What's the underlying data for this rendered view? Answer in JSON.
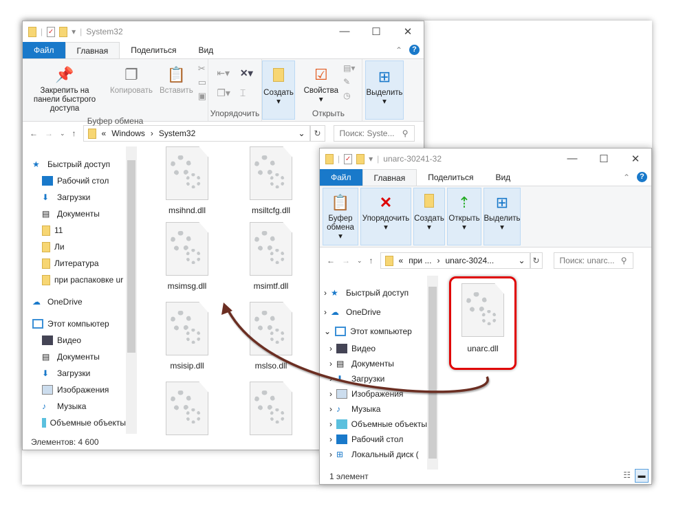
{
  "window1": {
    "title": "System32",
    "tabs": [
      "Файл",
      "Главная",
      "Поделиться",
      "Вид"
    ],
    "ribbon": {
      "pin": "Закрепить на панели быстрого доступа",
      "copy": "Копировать",
      "paste": "Вставить",
      "clipboard_group": "Буфер обмена",
      "organize_group": "Упорядочить",
      "create": "Создать",
      "properties": "Свойства",
      "open_group": "Открыть",
      "select": "Выделить"
    },
    "address": {
      "prefix": "«",
      "crumbs": [
        "Windows",
        "System32"
      ],
      "search_placeholder": "Поиск: Syste..."
    },
    "nav": [
      "Быстрый доступ",
      "Рабочий стол",
      "Загрузки",
      "Документы",
      "11",
      "Ли",
      "Литература",
      "при распаковке ur",
      "OneDrive",
      "Этот компьютер",
      "Видео",
      "Документы",
      "Загрузки",
      "Изображения",
      "Музыка",
      "Объемные объекты"
    ],
    "files": [
      "msihnd.dll",
      "msiltcfg.dll",
      "msimsg.dll",
      "msimtf.dll",
      "msisip.dll",
      "mslso.dll",
      "",
      ""
    ],
    "status": "Элементов: 4 600"
  },
  "window2": {
    "title": "unarc-30241-32",
    "tabs": [
      "Файл",
      "Главная",
      "Поделиться",
      "Вид"
    ],
    "ribbon": [
      "Буфер обмена",
      "Упорядочить",
      "Создать",
      "Открыть",
      "Выделить"
    ],
    "address": {
      "prefix": "«",
      "crumbs": [
        "при ...",
        "unarc-3024..."
      ],
      "search_placeholder": "Поиск: unarc..."
    },
    "nav": [
      "Быстрый доступ",
      "OneDrive",
      "Этот компьютер",
      "Видео",
      "Документы",
      "Загрузки",
      "Изображения",
      "Музыка",
      "Объемные объекты",
      "Рабочий стол",
      "Локальный диск ("
    ],
    "file": "unarc.dll",
    "status": "1 элемент"
  },
  "colors": {
    "accent": "#1979ca",
    "highlight": "#e00000",
    "arrow": "#6b2e22"
  }
}
